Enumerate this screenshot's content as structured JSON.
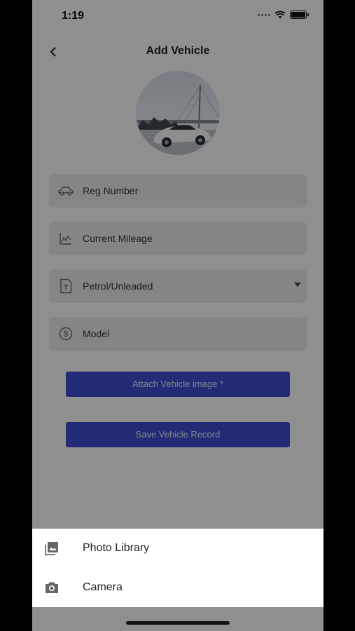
{
  "status_bar": {
    "time": "1:19"
  },
  "nav": {
    "title": "Add Vehicle",
    "back_icon": "chevron-left-icon"
  },
  "vehicle_photo": {
    "alt": "vehicle-photo"
  },
  "form": {
    "reg_number": {
      "placeholder": "Reg Number",
      "icon": "car-icon"
    },
    "current_mileage": {
      "placeholder": "Current Mileage",
      "icon": "chart-icon"
    },
    "fuel_type": {
      "value": "Petrol/Unleaded",
      "icon": "document-icon"
    },
    "model": {
      "placeholder": "Model",
      "icon": "dollar-circle-icon"
    }
  },
  "buttons": {
    "attach_image": "Attach Vehicle image *",
    "save_record": "Save Vehicle Record"
  },
  "action_sheet": {
    "items": [
      {
        "label": "Photo Library",
        "icon": "photo-library-icon"
      },
      {
        "label": "Camera",
        "icon": "camera-icon"
      }
    ]
  },
  "colors": {
    "primary": "#3b4bc8",
    "overlay": "rgba(0,0,0,0.42)"
  }
}
